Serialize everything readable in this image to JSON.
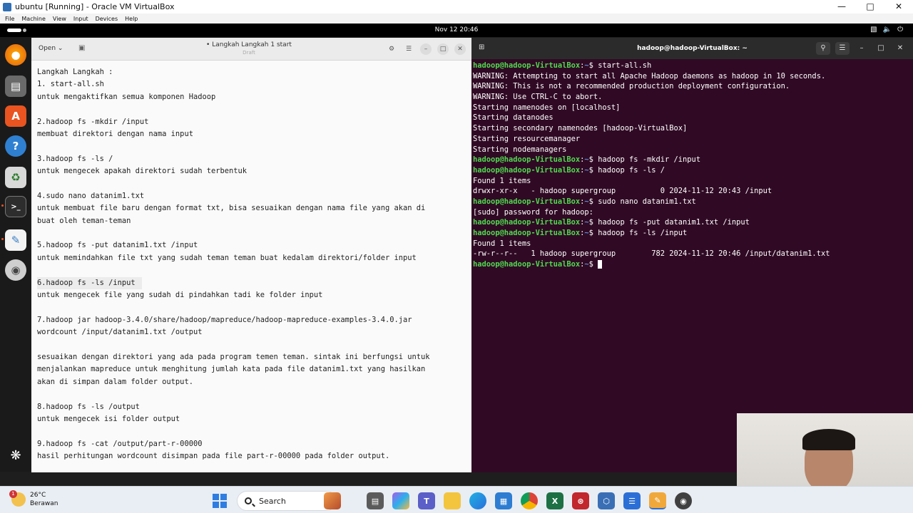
{
  "vbox": {
    "title": "ubuntu [Running] - Oracle VM VirtualBox",
    "menu": [
      "File",
      "Machine",
      "View",
      "Input",
      "Devices",
      "Help"
    ]
  },
  "topbar": {
    "clock": "Nov 12  20:46"
  },
  "editor": {
    "open_label": "Open",
    "title": "• Langkah Langkah 1 start",
    "subtitle": "Draft",
    "lines": [
      "Langkah Langkah :",
      "1. start-all.sh",
      "untuk mengaktifkan semua komponen Hadoop",
      "",
      "2.hadoop fs -mkdir /input",
      "membuat direktori dengan nama input",
      "",
      "3.hadoop fs -ls /",
      "untuk mengecek apakah direktori sudah terbentuk",
      "",
      "4.sudo nano datanim1.txt",
      "untuk membuat file baru dengan format txt, bisa sesuaikan dengan nama file yang akan di",
      "buat oleh teman-teman",
      "",
      "5.hadoop fs -put datanim1.txt /input",
      "untuk memindahkan file txt yang sudah teman teman buat kedalam direktori/folder input",
      "",
      "6.hadoop fs -ls /input",
      "untuk mengecek file yang sudah di pindahkan tadi ke folder input",
      "",
      "7.hadoop jar hadoop-3.4.0/share/hadoop/mapreduce/hadoop-mapreduce-examples-3.4.0.jar",
      "wordcount /input/datanim1.txt /output",
      "",
      "sesuaikan dengan direktori yang ada pada program temen teman. sintak ini berfungsi untuk",
      "menjalankan mapreduce untuk menghitung jumlah kata pada file datanim1.txt yang hasilkan",
      "akan di simpan dalam folder output.",
      "",
      "8.hadoop fs -ls /output",
      "untuk mengecek isi folder output",
      "",
      "9.hadoop fs -cat /output/part-r-00000",
      "hasil perhitungan wordcount disimpan pada file part-r-00000 pada folder output."
    ]
  },
  "terminal": {
    "title": "hadoop@hadoop-VirtualBox: ~",
    "prompt_user": "hadoop@hadoop-VirtualBox",
    "prompt_path": "~",
    "lines": [
      {
        "cmd": "start-all.sh"
      },
      {
        "out": "WARNING: Attempting to start all Apache Hadoop daemons as hadoop in 10 seconds."
      },
      {
        "out": "WARNING: This is not a recommended production deployment configuration."
      },
      {
        "out": "WARNING: Use CTRL-C to abort."
      },
      {
        "out": "Starting namenodes on [localhost]"
      },
      {
        "out": "Starting datanodes"
      },
      {
        "out": "Starting secondary namenodes [hadoop-VirtualBox]"
      },
      {
        "out": "Starting resourcemanager"
      },
      {
        "out": "Starting nodemanagers"
      },
      {
        "cmd": "hadoop fs -mkdir /input"
      },
      {
        "cmd": "hadoop fs -ls /"
      },
      {
        "out": "Found 1 items"
      },
      {
        "out": "drwxr-xr-x   - hadoop supergroup          0 2024-11-12 20:43 /input"
      },
      {
        "cmd": "sudo nano datanim1.txt"
      },
      {
        "out": "[sudo] password for hadoop:"
      },
      {
        "cmd": "hadoop fs -put datanim1.txt /input"
      },
      {
        "cmd": "hadoop fs -ls /input"
      },
      {
        "out": "Found 1 items"
      },
      {
        "out": "-rw-r--r--   1 hadoop supergroup        782 2024-11-12 20:46 /input/datanim1.txt"
      },
      {
        "cmd": "",
        "cursor": true
      }
    ]
  },
  "taskbar": {
    "temperature": "26°C",
    "weather": "Berawan",
    "notification_count": "1",
    "search_label": "Search"
  },
  "colors": {
    "terminal_bg": "#300a24",
    "prompt_green": "#4fd94f",
    "path_blue": "#5f8fe0",
    "ubuntu_orange": "#e95420",
    "spell_underline": "#c01c28"
  }
}
